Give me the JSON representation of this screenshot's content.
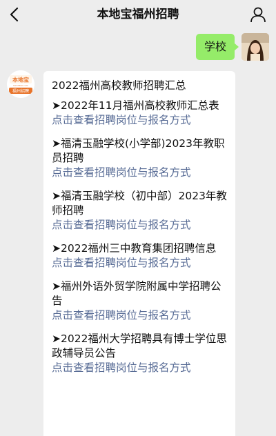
{
  "header": {
    "title": "本地宝福州招聘"
  },
  "chat": {
    "me_message": "学校",
    "bot_logo_text_top": "本地宝",
    "bot_logo_text_url": "bendibao.com",
    "bot_logo_text_bottom": "福州招聘"
  },
  "card": {
    "title": "2022福州高校教师招聘汇总",
    "items": [
      {
        "text": "➤2022年11月福州高校教师汇总表",
        "link": "点击查看招聘岗位与报名方式"
      },
      {
        "text": "➤福清玉融学校(小学部)2023年教职员招聘",
        "link": "点击查看招聘岗位与报名方式"
      },
      {
        "text": "➤福清玉融学校（初中部）2023年教师招聘",
        "link": "点击查看招聘岗位与报名方式"
      },
      {
        "text": "➤2022福州三中教育集团招聘信息",
        "link": "点击查看招聘岗位与报名方式"
      },
      {
        "text": "➤福州外语外贸学院附属中学招聘公告",
        "link": "点击查看招聘岗位与报名方式"
      },
      {
        "text": "➤2022福州大学招聘具有博士学位思政辅导员公告",
        "link": "点击查看招聘岗位与报名方式"
      }
    ]
  },
  "colors": {
    "background": "#ededed",
    "bubble_me": "#95ec69",
    "link": "#576b95",
    "logo_orange": "#e8742a"
  },
  "icons": {
    "back": "chevron-left-icon",
    "user": "user-icon"
  }
}
